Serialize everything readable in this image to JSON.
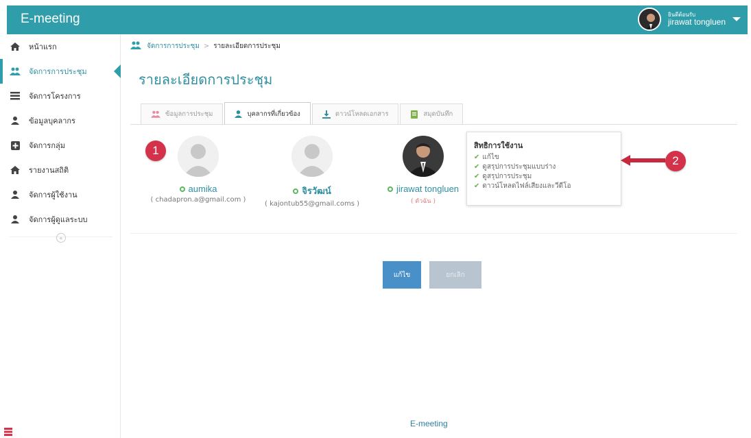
{
  "app": {
    "title": "E-meeting"
  },
  "user": {
    "greeting": "ยินดีต้อนรับ",
    "name": "jirawat tongluen"
  },
  "sidebar": {
    "items": [
      {
        "label": "หน้าแรก",
        "icon": "home-icon"
      },
      {
        "label": "จัดการการประชุม",
        "icon": "users-icon",
        "active": true
      },
      {
        "label": "จัดการโครงการ",
        "icon": "list-icon"
      },
      {
        "label": "ข้อมูลบุคลากร",
        "icon": "user-icon"
      },
      {
        "label": "จัดการกลุ่ม",
        "icon": "plus-box-icon"
      },
      {
        "label": "รายงานสถิติ",
        "icon": "home-icon"
      },
      {
        "label": "จัดการผู้ใช้งาน",
        "icon": "user-icon"
      },
      {
        "label": "จัดการผู้ดูแลระบบ",
        "icon": "user-icon"
      }
    ],
    "collapse": "«"
  },
  "breadcrumb": {
    "parent": "จัดการการประชุม",
    "separator": ">",
    "current": "รายละเอียดการประชุม"
  },
  "page": {
    "title": "รายละเอียดการประชุม"
  },
  "tabs": [
    {
      "label": "ข้อมูลการประชุม",
      "icon": "users-icon"
    },
    {
      "label": "บุคลากรที่เกี่ยวข้อง",
      "icon": "user-icon",
      "active": true
    },
    {
      "label": "ดาวน์โหลดเอกสาร",
      "icon": "download-icon"
    },
    {
      "label": "สมุดบันทึก",
      "icon": "notebook-icon"
    }
  ],
  "people": [
    {
      "name": "aumika",
      "email": "( chadapron.a@gmail.com )",
      "role": ""
    },
    {
      "name": "จิรวัฒน์",
      "email": "( kajontub55@gmail.coms )",
      "role": ""
    },
    {
      "name": "jirawat tongluen",
      "email": "",
      "role": "( ตัวฉัน )"
    }
  ],
  "permissions": {
    "title": "สิทธิการใช้งาน",
    "items": [
      "แก้ไข",
      "ดูสรุปการประชุมแบบร่าง",
      "ดูสรุปการประชุม",
      "ดาวน์โหลดไฟล์เสียงและวีดีโอ"
    ]
  },
  "annotations": {
    "badge1": "1",
    "badge2": "2"
  },
  "buttons": {
    "edit": "แก้ไข",
    "cancel": "ยกเลิก"
  },
  "footer": {
    "text": "E-meeting"
  },
  "colors": {
    "primary": "#2f9eaa",
    "accent_text": "#2f8fa0",
    "badge": "#d4314a",
    "edit_btn": "#4a90c8"
  }
}
